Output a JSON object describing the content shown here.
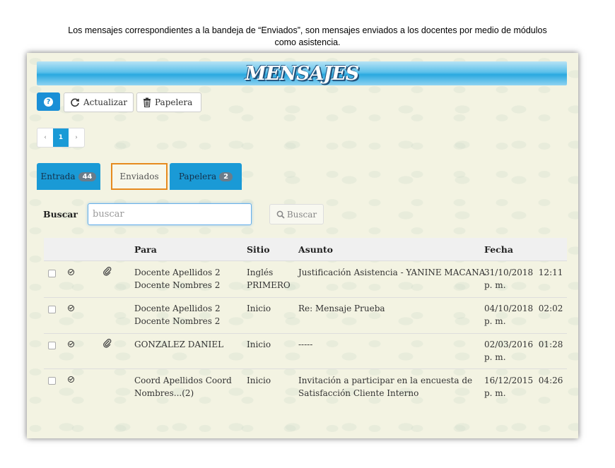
{
  "caption": {
    "line1": "Los mensajes correspondientes a la bandeja de “Enviados”, son mensajes enviados a los docentes por medio de módulos",
    "line2": "como asistencia."
  },
  "banner": {
    "title": "MENSAJES"
  },
  "toolbar": {
    "help_label": "?",
    "refresh_label": "Actualizar",
    "trash_label": "Papelera"
  },
  "pager": {
    "prev": "‹",
    "current": "1",
    "next": "›"
  },
  "tabs": [
    {
      "label": "Entrada",
      "badge": "44"
    },
    {
      "label": "Enviados"
    },
    {
      "label": "Papelera",
      "badge": "2"
    }
  ],
  "search": {
    "label": "Buscar",
    "placeholder": "buscar",
    "button": "Buscar"
  },
  "table": {
    "headers": {
      "para": "Para",
      "sitio": "Sitio",
      "asunto": "Asunto",
      "fecha": "Fecha"
    },
    "rows": [
      {
        "para1": "Docente Apellidos 2",
        "para2": "Docente Nombres 2",
        "sitio1": "Inglés",
        "sitio2": "PRIMERO",
        "asunto1": "Justificación Asistencia - YANINE MACANA",
        "asunto2": "",
        "fecha1": "31/10/2018  12:11",
        "fecha2": "p. m.",
        "attachment": true
      },
      {
        "para1": "Docente Apellidos 2",
        "para2": "Docente Nombres 2",
        "sitio1": "Inicio",
        "sitio2": "",
        "asunto1": "Re: Mensaje Prueba",
        "asunto2": "",
        "fecha1": "04/10/2018  02:02",
        "fecha2": "p. m.",
        "attachment": false
      },
      {
        "para1": "GONZALEZ DANIEL",
        "para2": "",
        "sitio1": "Inicio",
        "sitio2": "",
        "asunto1": "-----",
        "asunto2": "",
        "fecha1": "02/03/2016  01:28",
        "fecha2": "p. m.",
        "attachment": true
      },
      {
        "para1": "Coord Apellidos Coord",
        "para2": "Nombres...(2)",
        "sitio1": "Inicio",
        "sitio2": "",
        "asunto1": "Invitación a participar en la encuesta de",
        "asunto2": "Satisfacción Cliente Interno",
        "fecha1": "16/12/2015  04:26",
        "fecha2": "p. m.",
        "attachment": false
      }
    ]
  }
}
